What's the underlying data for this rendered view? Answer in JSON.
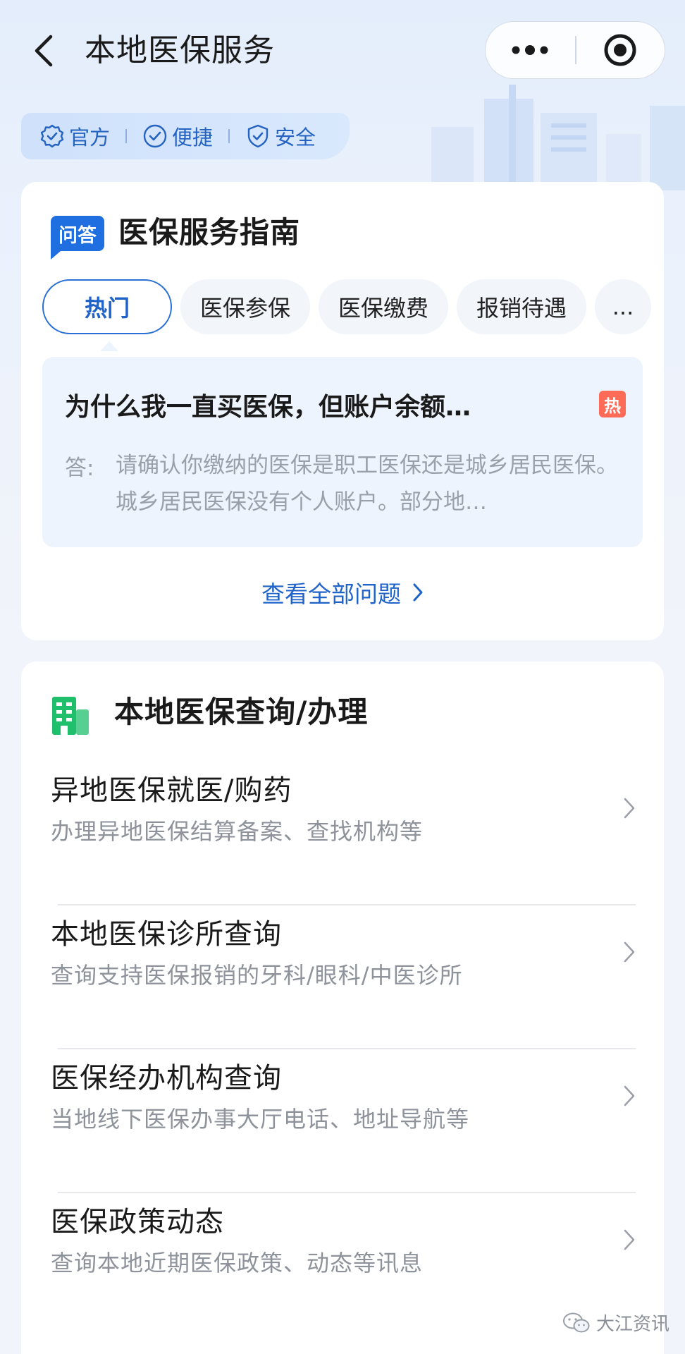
{
  "nav": {
    "title": "本地医保服务"
  },
  "badges": [
    "官方",
    "便捷",
    "安全"
  ],
  "guide": {
    "tag": "问答",
    "title": "医保服务指南",
    "tabs": [
      "热门",
      "医保参保",
      "医保缴费",
      "报销待遇",
      "..."
    ],
    "question": "为什么我一直买医保，但账户余额…",
    "hot_badge": "热",
    "answer_label": "答:",
    "answer": "请确认你缴纳的医保是职工医保还是城乡居民医保。城乡居民医保没有个人账户。部分地…",
    "view_all": "查看全部问题"
  },
  "services": {
    "title": "本地医保查询/办理",
    "items": [
      {
        "title": "异地医保就医/购药",
        "subtitle": "办理异地医保结算备案、查找机构等"
      },
      {
        "title": "本地医保诊所查询",
        "subtitle": "查询支持医保报销的牙科/眼科/中医诊所"
      },
      {
        "title": "医保经办机构查询",
        "subtitle": "当地线下医保办事大厅电话、地址导航等"
      },
      {
        "title": "医保政策动态",
        "subtitle": "查询本地近期医保政策、动态等讯息"
      }
    ]
  },
  "watermark": "大江资讯",
  "colors": {
    "accent": "#1f63c9",
    "hot": "#ff6b57",
    "building_icon": "#1fbf6b"
  }
}
